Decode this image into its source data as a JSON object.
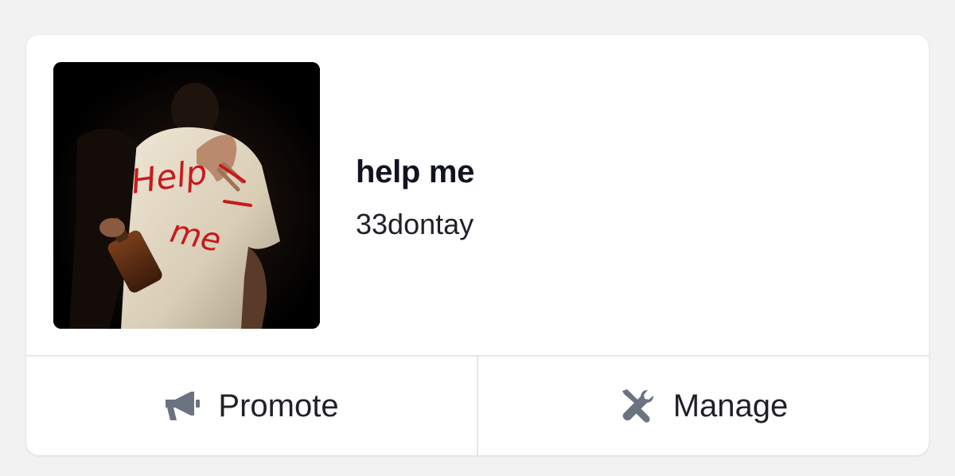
{
  "track": {
    "title": "help me",
    "artist": "33dontay",
    "artwork_icon": "album-artwork-image",
    "artwork_text": "Help me"
  },
  "actions": {
    "promote": {
      "label": "Promote",
      "icon": "megaphone-icon"
    },
    "manage": {
      "label": "Manage",
      "icon": "tools-icon"
    }
  },
  "colors": {
    "background": "#f2f2f3",
    "card": "#ffffff",
    "title_text": "#111320",
    "icon": "#6b7280",
    "divider": "#e6e6ea",
    "artwork_red": "#c8191c"
  }
}
